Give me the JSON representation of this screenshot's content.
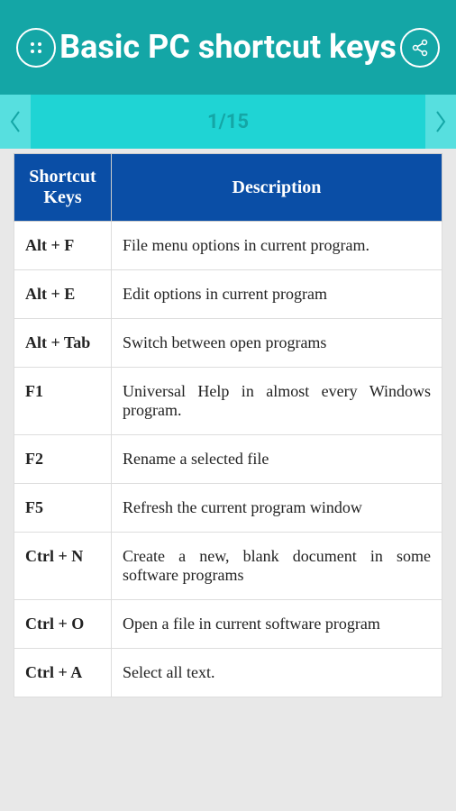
{
  "header": {
    "title": "Basic PC shortcut keys"
  },
  "pagination": {
    "indicator": "1/15"
  },
  "table": {
    "headers": {
      "keys": "Shortcut Keys",
      "description": "Description"
    },
    "rows": [
      {
        "key": "Alt + F",
        "desc": "File menu options in current program."
      },
      {
        "key": "Alt + E",
        "desc": "Edit options in current program"
      },
      {
        "key": "Alt + Tab",
        "desc": "Switch between open programs"
      },
      {
        "key": "F1",
        "desc": "Universal Help in almost every Windows program."
      },
      {
        "key": "F2",
        "desc": "Rename a selected file"
      },
      {
        "key": "F5",
        "desc": "Refresh the current program window"
      },
      {
        "key": "Ctrl + N",
        "desc": "Create a new, blank document in some software programs"
      },
      {
        "key": "Ctrl + O",
        "desc": "Open a file in current software program"
      },
      {
        "key": "Ctrl + A",
        "desc": "Select all text."
      }
    ]
  }
}
